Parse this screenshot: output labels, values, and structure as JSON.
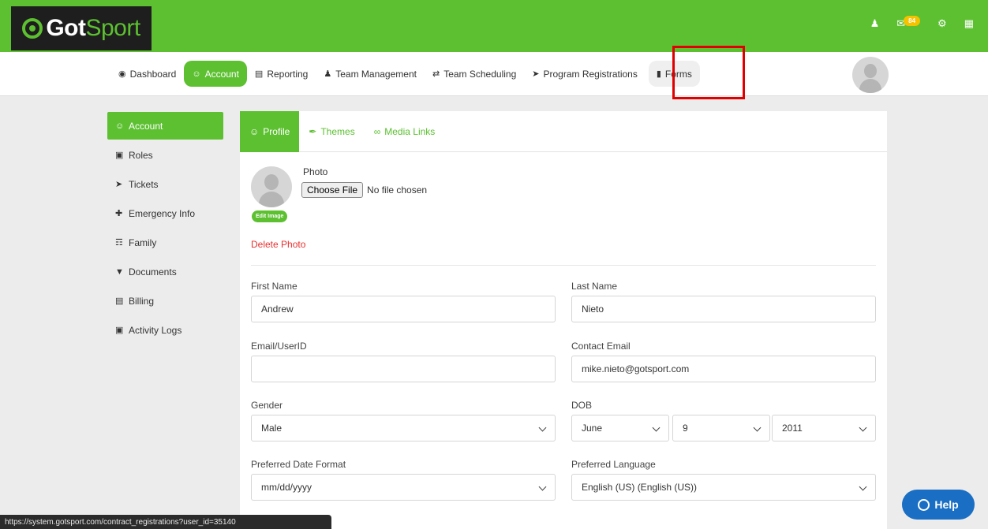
{
  "app": {
    "logo_got": "Got",
    "logo_sport": "Sport"
  },
  "topbar": {
    "mail_count": "84"
  },
  "nav": [
    {
      "label": "Dashboard",
      "icon": "dashboard-icon"
    },
    {
      "label": "Account",
      "icon": "user-circle-icon"
    },
    {
      "label": "Reporting",
      "icon": "file-icon"
    },
    {
      "label": "Team Management",
      "icon": "users-icon"
    },
    {
      "label": "Team Scheduling",
      "icon": "exchange-icon"
    },
    {
      "label": "Program Registrations",
      "icon": "send-icon"
    },
    {
      "label": "Forms",
      "icon": "document-icon"
    }
  ],
  "sidebar": [
    {
      "label": "Account"
    },
    {
      "label": "Roles"
    },
    {
      "label": "Tickets"
    },
    {
      "label": "Emergency Info"
    },
    {
      "label": "Family"
    },
    {
      "label": "Documents"
    },
    {
      "label": "Billing"
    },
    {
      "label": "Activity Logs"
    }
  ],
  "tabs": [
    {
      "label": "Profile"
    },
    {
      "label": "Themes"
    },
    {
      "label": "Media Links"
    }
  ],
  "photo": {
    "label": "Photo",
    "choose_button": "Choose File",
    "file_status": "No file chosen",
    "edit_image": "Edit Image",
    "delete_photo": "Delete Photo"
  },
  "form": {
    "first_name_label": "First Name",
    "first_name_value": "Andrew",
    "last_name_label": "Last Name",
    "last_name_value": "Nieto",
    "email_label": "Email/UserID",
    "email_value": "",
    "contact_email_label": "Contact Email",
    "contact_email_value": "mike.nieto@gotsport.com",
    "gender_label": "Gender",
    "gender_value": "Male",
    "dob_label": "DOB",
    "dob_month": "June",
    "dob_day": "9",
    "dob_year": "2011",
    "date_format_label": "Preferred Date Format",
    "date_format_value": "mm/dd/yyyy",
    "language_label": "Preferred Language",
    "language_value": "English (US) (English (US))"
  },
  "status_url": "https://system.gotsport.com/contract_registrations?user_id=35140",
  "help_label": "Help",
  "colors": {
    "brand_green": "#5cc031",
    "logo_dark": "#1e1e1e",
    "highlight_red": "#e00000",
    "help_blue": "#1a6fc4",
    "badge_yellow": "#f5c200"
  }
}
